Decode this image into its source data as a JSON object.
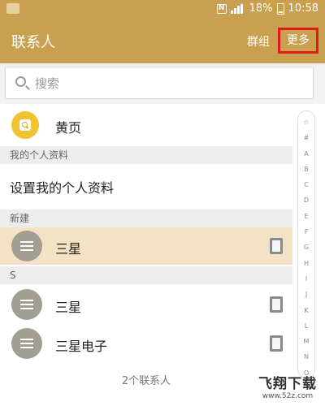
{
  "status_bar": {
    "battery": "18%",
    "time": "10:58",
    "nfc_label": "N",
    "icons": [
      "notification-icon",
      "nfc-icon",
      "signal-icon",
      "battery-icon"
    ]
  },
  "app_bar": {
    "title": "联系人",
    "groups_label": "群组",
    "more_label": "更多"
  },
  "search": {
    "placeholder": "搜索"
  },
  "yellow_pages": {
    "label": "黄页"
  },
  "sections": {
    "profile_header": "我的个人资料",
    "profile_action": "设置我的个人资料",
    "new_header": "新建",
    "s_header": "S"
  },
  "contacts": [
    {
      "name": "三星",
      "highlighted": true
    },
    {
      "name": "三星",
      "highlighted": false
    },
    {
      "name": "三星电子",
      "highlighted": false
    }
  ],
  "index_letters": [
    "☆",
    "#",
    "A",
    "B",
    "C",
    "D",
    "E",
    "F",
    "G",
    "H",
    "I",
    "J",
    "K",
    "L",
    "M",
    "N",
    "O"
  ],
  "footer": {
    "count_text": "2个联系人"
  },
  "watermark": {
    "title": "飞翔下载",
    "url": "www.52z.com"
  },
  "colors": {
    "app_bar": "#c9a04f",
    "highlight_row": "#f3e2c6",
    "more_outline": "#e01b1b",
    "yellow_pages_icon": "#f1c232",
    "avatar": "#a39e93"
  }
}
